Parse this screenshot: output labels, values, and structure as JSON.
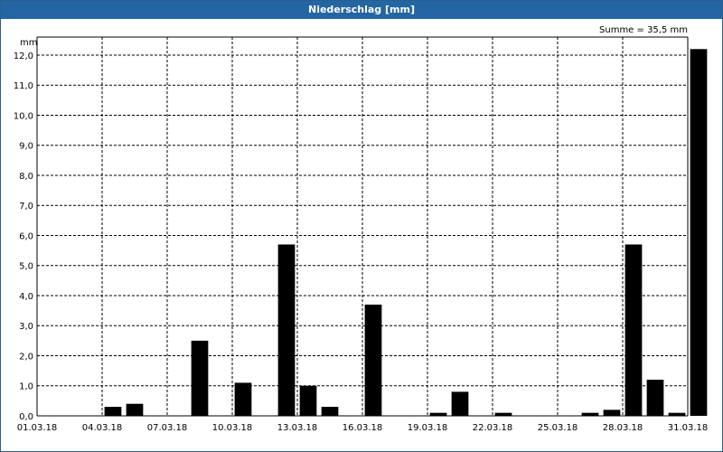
{
  "window": {
    "title": "Niederschlag [mm]"
  },
  "chart_data": {
    "type": "bar",
    "title": "Niederschlag [mm]",
    "ylabel": "mm",
    "summary": "Summe = 35,5 mm",
    "ylim": [
      0,
      12.6
    ],
    "yticks": [
      0,
      1,
      2,
      3,
      4,
      5,
      6,
      7,
      8,
      9,
      10,
      11,
      12
    ],
    "ytick_labels": [
      "0,0",
      "1,0",
      "2,0",
      "3,0",
      "4,0",
      "5,0",
      "6,0",
      "7,0",
      "8,0",
      "9,0",
      "10,0",
      "11,0",
      "12,0"
    ],
    "xtick_labels": [
      "01.03.18",
      "04.03.18",
      "07.03.18",
      "10.03.18",
      "13.03.18",
      "16.03.18",
      "19.03.18",
      "22.03.18",
      "25.03.18",
      "28.03.18",
      "31.03.18"
    ],
    "categories": [
      "01.03.18",
      "02.03.18",
      "03.03.18",
      "04.03.18",
      "05.03.18",
      "06.03.18",
      "07.03.18",
      "08.03.18",
      "09.03.18",
      "10.03.18",
      "11.03.18",
      "12.03.18",
      "13.03.18",
      "14.03.18",
      "15.03.18",
      "16.03.18",
      "17.03.18",
      "18.03.18",
      "19.03.18",
      "20.03.18",
      "21.03.18",
      "22.03.18",
      "23.03.18",
      "24.03.18",
      "25.03.18",
      "26.03.18",
      "27.03.18",
      "28.03.18",
      "29.03.18",
      "30.03.18",
      "31.03.18"
    ],
    "values": [
      0,
      0,
      0,
      0.3,
      0.4,
      0,
      0,
      2.5,
      0,
      1.1,
      0,
      5.7,
      1.0,
      0.3,
      0,
      3.7,
      0,
      0,
      0.1,
      0.8,
      0,
      0.1,
      0,
      0,
      0,
      0.1,
      0.2,
      5.7,
      1.2,
      0.1,
      12.2
    ],
    "grid": true,
    "bar_color": "#000000",
    "grid_color": "#000000"
  }
}
